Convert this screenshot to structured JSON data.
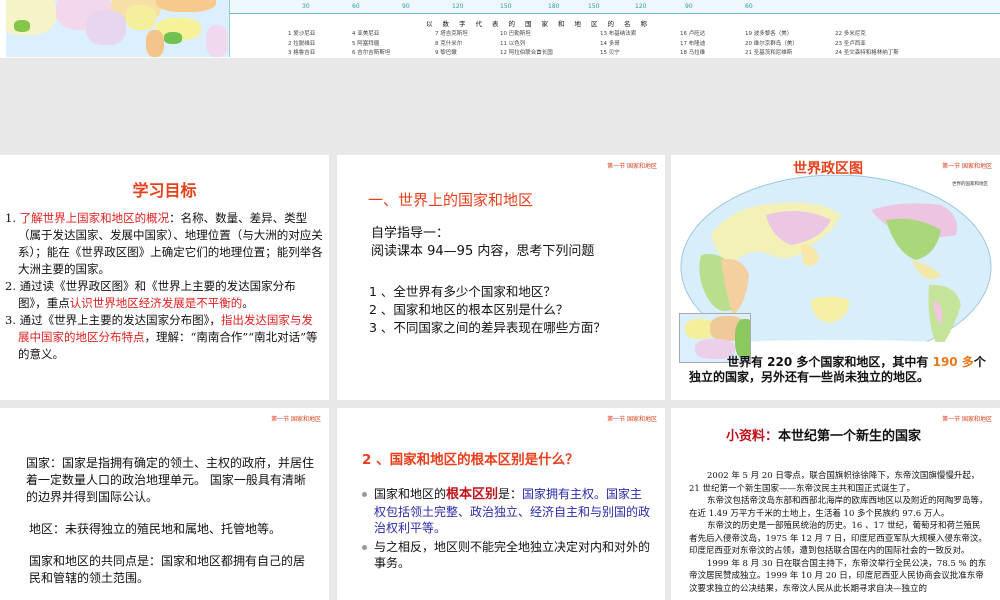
{
  "top_slide": {
    "axis_labels": [
      "30",
      "60",
      "90",
      "120",
      "150",
      "180",
      "150",
      "120",
      "90",
      "60"
    ],
    "table_title": "以数字代表的国家和地区的名称",
    "countries": [
      [
        "1 爱沙尼亚",
        "2 拉脱维亚",
        "3 格鲁吉亚"
      ],
      [
        "4 亚美尼亚",
        "5 阿塞拜疆",
        "6 吉尔吉斯斯坦"
      ],
      [
        "7 塔吉克斯坦",
        "8 克什米尔",
        "9 黎巴嫩"
      ],
      [
        "10 巴勒斯坦",
        "11 以色列",
        "12 阿拉伯联合酋长国"
      ],
      [
        "13 布基纳法索",
        "14 多哥",
        "15 贝宁"
      ],
      [
        "16 卢旺达",
        "17 布隆迪",
        "18 马拉维"
      ],
      [
        "19 波多黎各（美）",
        "20 维尔京群岛（美）",
        "21 圣基茨和尼维斯"
      ],
      [
        "22 多米尼克",
        "23 圣卢西亚",
        "24 圣文森特和格林纳丁斯"
      ]
    ]
  },
  "section_header": "第一节 国家和地区",
  "slide1": {
    "title": "学习目标",
    "items": [
      {
        "num": "1.",
        "red": "了解世界上国家和地区的概况",
        "text": "：名称、数量、差异、类型（属于发达国家、发展中国家）、地理位置（与大洲的对应关系）；能在《世界政区图》上确定它们的地理位置；能列举各大洲主要的国家。"
      },
      {
        "num": "2.",
        "pre": "通过读《世界政区图》和《世界上主要的发达国家分布图》，重点",
        "red": "认识世界地区经济发展是不平衡的",
        "post": "。"
      },
      {
        "num": "3.",
        "pre": "通过《世界上主要的发达国家分布图》，",
        "red": "指出发达国家与发展中国家的地区分布特点",
        "post": "，理解：“南南合作”“南北对话”等的意义。"
      }
    ]
  },
  "slide2": {
    "title": "一、世界上的国家和地区",
    "guide": "自学指导一：",
    "reading": "阅读课本 94—95 内容，思考下列问题",
    "questions": [
      "1 、全世界有多少个国家和地区？",
      "2 、国家和地区的根本区别是什么？",
      "3 、不同国家之间的差异表现在哪些方面？"
    ]
  },
  "slide3": {
    "title": "世界政区图",
    "map_caption": "世界的国家和地区",
    "text_pre": "世界有 220 多个国家和地区，其中有 ",
    "text_red": "190 多",
    "text_post": "个独立的国家，另外还有一些尚未独立的地区。"
  },
  "slide4": {
    "p1": "国家：国家是指拥有确定的领土、主权的政府，并居住着一定数量人口的政治地理单元。 国家一般具有清晰的边界并得到国际公认。",
    "p2": "地区：未获得独立的殖民地和属地、托管地等。",
    "p3": "国家和地区的共同点是：国家和地区都拥有自己的居民和管辖的领土范围。"
  },
  "slide5": {
    "title": "2 、国家和地区的根本区别是什么？",
    "b1_pre": "国家和地区的",
    "b1_red": "根本区别",
    "b1_mid": "是：",
    "b1_blue": "国家拥有主权。国家主权包括领土完整、政治独立、经济自主和与别国的政治权利平等。",
    "b2": "与之相反，地区则不能完全地独立决定对内和对外的事务。"
  },
  "slide6": {
    "title_red": "小资料：",
    "title_rest": "本世纪第一个新生的国家",
    "paras": [
      "2002 年 5 月 20 日零点，联合国旗帜徐徐降下，东帝汶国旗慢慢升起，21 世纪第一个新生国家——东帝汶民主共和国正式诞生了。",
      "东帝汶包括帝汶岛东部和西部北海岸的欧库西地区以及附近的阿陶罗岛等，在近 1.49 万平方千米的土地上，生活着 10 多个民族约 97.6 万人。",
      "东帝汶的历史是一部殖民统治的历史。16 、17 世纪，葡萄牙和荷兰殖民者先后入侵帝汶岛，1975 年 12 月 7 日，印度尼西亚军队大规模入侵东帝汶。印度尼西亚对东帝汶的占领，遭到包括联合国在内的国际社会的一致反对。",
      "1999 年 8 月 30 日在联合国主持下，东帝汶举行全民公决，78.5 % 的东帝汶居民赞成独立。1999 年 10 月 20 日，印度尼西亚人民协商会议批准东帝汶要求独立的公决结果，东帝汶人民从此长期寻求自决—独立的"
    ]
  },
  "colors": {
    "title_red": "#e8401c",
    "text_red": "#e02020",
    "text_blue": "#2b2ba8",
    "background": "#e8e8e8"
  }
}
